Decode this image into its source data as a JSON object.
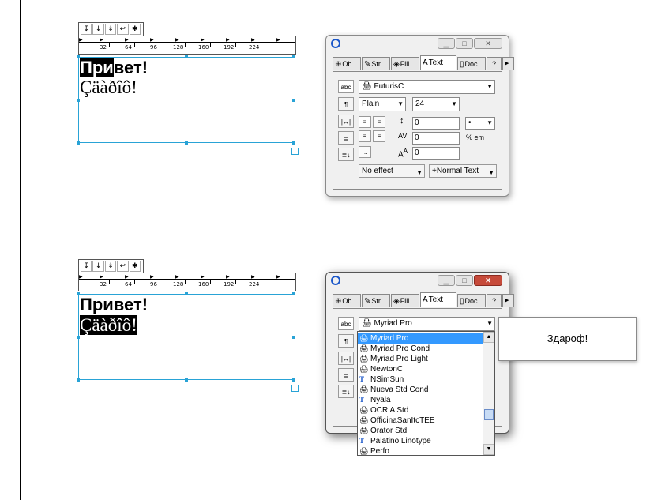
{
  "text_frames": [
    {
      "ruler_tab_icons": [
        "tab-left-icon",
        "tab-center-icon",
        "tab-right-icon",
        "tab-decimal-icon",
        "tab-clear-icon"
      ],
      "ruler_tab_glyphs": [
        "↧",
        "↓",
        "↡",
        "↩",
        "✱"
      ],
      "ruler_numbers": [
        "32",
        "64",
        "96",
        "128",
        "160",
        "192",
        "224"
      ],
      "line1_selected": "При",
      "line1_rest": "вет!",
      "line2_text": "Çäàðîô!",
      "line2_selected": ""
    },
    {
      "ruler_tab_icons": [
        "tab-left-icon",
        "tab-center-icon",
        "tab-right-icon",
        "tab-decimal-icon",
        "tab-clear-icon"
      ],
      "ruler_tab_glyphs": [
        "↧",
        "↓",
        "↡",
        "↩",
        "✱"
      ],
      "ruler_numbers": [
        "32",
        "64",
        "96",
        "128",
        "160",
        "192",
        "224"
      ],
      "line1_selected": "",
      "line1_rest": "Привет!",
      "line2_text": "",
      "line2_selected": "Çäàðîô!"
    }
  ],
  "palette_top": {
    "tabs": [
      "Ob",
      "Str",
      "Fill",
      "Text",
      "Doc"
    ],
    "help_glyph": "?",
    "scroll_glyph": "▶",
    "font_combo": "FuturisC",
    "style_combo": "Plain",
    "size_combo": "24",
    "leading": "0",
    "leading_unit": "•",
    "tracking": "0",
    "tracking_unit": "% em",
    "baseline": "0",
    "effect": "No effect",
    "text_style": "+Normal Text",
    "side_labels": [
      "abc",
      "¶",
      "|↔|",
      "≣",
      "≣↓"
    ]
  },
  "palette_bottom": {
    "tabs": [
      "Ob",
      "Str",
      "Fill",
      "Text",
      "Doc"
    ],
    "help_glyph": "?",
    "scroll_glyph": "▶",
    "font_combo": "Myriad Pro",
    "side_labels": [
      "abc",
      "¶",
      "|↔|",
      "≣",
      "≣↓"
    ],
    "close_glyph": "✕"
  },
  "font_list": [
    {
      "name": "Myriad Pro",
      "kind": "type1",
      "highlighted": true
    },
    {
      "name": "Myriad Pro Cond",
      "kind": "type1",
      "highlighted": false
    },
    {
      "name": "Myriad Pro Light",
      "kind": "type1",
      "highlighted": false
    },
    {
      "name": "NewtonC",
      "kind": "type1",
      "highlighted": false
    },
    {
      "name": "NSimSun",
      "kind": "truetype",
      "highlighted": false
    },
    {
      "name": "Nueva Std Cond",
      "kind": "type1",
      "highlighted": false
    },
    {
      "name": "Nyala",
      "kind": "truetype",
      "highlighted": false
    },
    {
      "name": "OCR A Std",
      "kind": "type1",
      "highlighted": false
    },
    {
      "name": "OfficinaSanItcTEE",
      "kind": "type1",
      "highlighted": false
    },
    {
      "name": "Orator Std",
      "kind": "type1",
      "highlighted": false
    },
    {
      "name": "Palatino Linotype",
      "kind": "truetype",
      "highlighted": false
    },
    {
      "name": "Perfo",
      "kind": "type1",
      "highlighted": false
    }
  ],
  "tooltip_text": "Здароф!",
  "colors": {
    "selection_handles": "#29a3d6",
    "list_highlight": "#3399ff"
  }
}
